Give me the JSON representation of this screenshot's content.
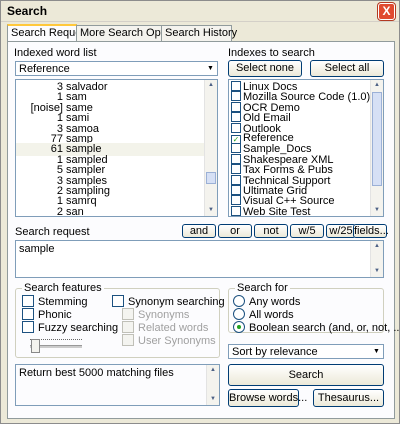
{
  "window": {
    "title": "Search",
    "close_glyph": "X"
  },
  "tabs": [
    "Search Request",
    "More Search Options",
    "Search History"
  ],
  "indexed_word_list": {
    "label": "Indexed word list",
    "selected": "Reference",
    "words": [
      {
        "count": "3",
        "word": "salvador"
      },
      {
        "count": "1",
        "word": "sam"
      },
      {
        "count": "[noise]",
        "word": "same"
      },
      {
        "count": "1",
        "word": "sami"
      },
      {
        "count": "3",
        "word": "samoa"
      },
      {
        "count": "77",
        "word": "samp"
      },
      {
        "count": "61",
        "word": "sample",
        "highlighted": true
      },
      {
        "count": "1",
        "word": "sampled"
      },
      {
        "count": "5",
        "word": "sampler"
      },
      {
        "count": "3",
        "word": "samples"
      },
      {
        "count": "2",
        "word": "sampling"
      },
      {
        "count": "1",
        "word": "samrq"
      },
      {
        "count": "2",
        "word": "san"
      }
    ]
  },
  "indexes": {
    "label": "Indexes to search",
    "select_none": "Select none",
    "select_all": "Select all",
    "items": [
      {
        "name": "Linux Docs",
        "checked": false
      },
      {
        "name": "Mozilla Source Code (1.0)",
        "checked": false
      },
      {
        "name": "OCR Demo",
        "checked": false
      },
      {
        "name": "Old Email",
        "checked": false
      },
      {
        "name": "Outlook",
        "checked": false
      },
      {
        "name": "Reference",
        "checked": true
      },
      {
        "name": "Sample_Docs",
        "checked": false
      },
      {
        "name": "Shakespeare XML",
        "checked": false
      },
      {
        "name": "Tax Forms & Pubs",
        "checked": false
      },
      {
        "name": "Technical Support",
        "checked": false
      },
      {
        "name": "Ultimate Grid",
        "checked": false
      },
      {
        "name": "Visual C++ Source",
        "checked": false
      },
      {
        "name": "Web Site Test",
        "checked": false
      }
    ]
  },
  "search_request": {
    "label": "Search request",
    "value": "sample",
    "ops": [
      "and",
      "or",
      "not",
      "w/5",
      "w/25",
      "fields..."
    ]
  },
  "features": {
    "title": "Search features",
    "stemming": "Stemming",
    "phonic": "Phonic",
    "fuzzy": "Fuzzy searching",
    "synonym": "Synonym searching",
    "synonyms": "Synonyms",
    "related": "Related words",
    "user_synonyms": "User Synonyms"
  },
  "search_for": {
    "title": "Search for",
    "options": [
      "Any words",
      "All words",
      "Boolean search (and, or, not, ...)"
    ],
    "selected_index": 2
  },
  "sort": {
    "selected": "Sort by relevance"
  },
  "status": {
    "text": "Return best 5000 matching files"
  },
  "buttons": {
    "search": "Search",
    "browse": "Browse words...",
    "thesaurus": "Thesaurus..."
  },
  "colors": {
    "check_green": "#21a121",
    "tab_accent": "#ffc83c"
  }
}
